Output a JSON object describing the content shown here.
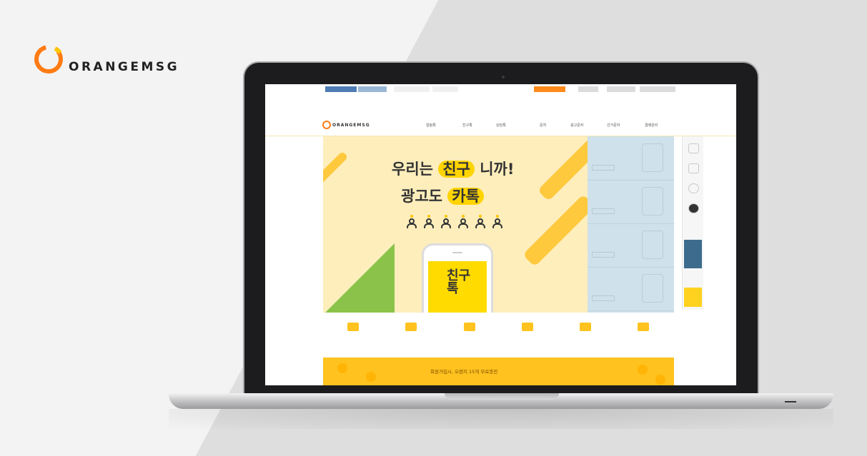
{
  "brand": {
    "name": "ORANGEMSG",
    "ring_color": "#ff7b14",
    "ring_accent": "#ffc400"
  },
  "screen": {
    "topbar": {
      "left_tabs": [
        "",
        "",
        "",
        ""
      ],
      "right_items": [
        "",
        "",
        "",
        ""
      ]
    },
    "site_logo": "ORANGEMSG",
    "nav": [
      "알림톡",
      "친구톡",
      "상담톡",
      "문자",
      "광고문자",
      "선거문자",
      "결제관리"
    ],
    "hero": {
      "line1_pre": "우리는",
      "line1_hl": "친구",
      "line1_post": "니까!",
      "line2_pre": "광고도",
      "line2_hl": "카톡",
      "phone_text_1": "친구",
      "phone_text_2": "톡"
    },
    "icon_labels": [
      "",
      "",
      "",
      "",
      "",
      ""
    ],
    "banner": "회원가입시, 오렌지 15개 무료충전"
  },
  "colors": {
    "accent_yellow": "#ffc21f",
    "hero_bg": "#fdeebc",
    "side_blue": "#cfe1ea",
    "tab_blue": "#4f7cb5"
  }
}
